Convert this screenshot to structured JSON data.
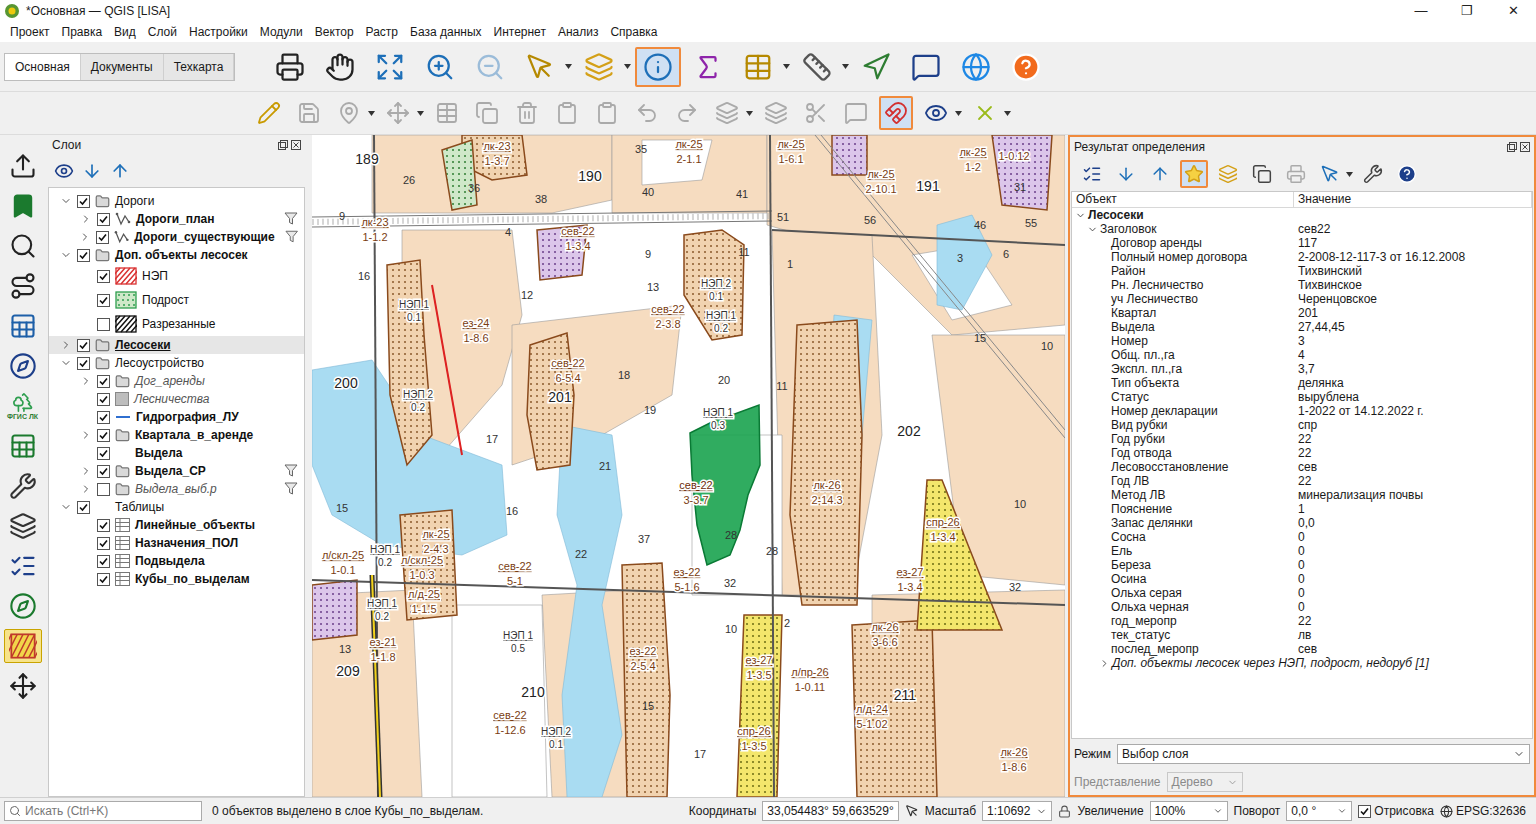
{
  "window": {
    "title": "*Основная — QGIS [LISA]",
    "controls": [
      "—",
      "❐",
      "✕"
    ]
  },
  "menu": [
    "Проект",
    "Правка",
    "Вид",
    "Слой",
    "Настройки",
    "Модули",
    "Вектор",
    "Растр",
    "База данных",
    "Интернет",
    "Анализ",
    "Справка"
  ],
  "ribbon_tabs": [
    {
      "label": "Основная",
      "selected": true
    },
    {
      "label": "Документы",
      "selected": false
    },
    {
      "label": "Техкарта",
      "selected": false
    }
  ],
  "toolbar_main": [
    {
      "pressed": false,
      "disabled": false,
      "dropdown": false
    },
    {
      "pressed": false,
      "disabled": false,
      "dropdown": false
    },
    {
      "pressed": false,
      "disabled": false,
      "dropdown": false
    },
    {
      "pressed": false,
      "disabled": false,
      "dropdown": false
    },
    {
      "pressed": false,
      "disabled": true,
      "dropdown": false
    },
    {
      "pressed": false,
      "disabled": false,
      "dropdown": true
    },
    {
      "pressed": false,
      "disabled": false,
      "dropdown": true
    },
    {
      "pressed": true,
      "disabled": false,
      "dropdown": false
    },
    {
      "pressed": false,
      "disabled": false,
      "dropdown": false
    },
    {
      "pressed": false,
      "disabled": false,
      "dropdown": true
    },
    {
      "pressed": false,
      "disabled": false,
      "dropdown": true
    },
    {
      "pressed": false,
      "disabled": false,
      "dropdown": false
    },
    {
      "pressed": false,
      "disabled": false,
      "dropdown": false
    },
    {
      "pressed": false,
      "disabled": false,
      "dropdown": false
    },
    {
      "pressed": false,
      "disabled": false,
      "dropdown": false
    }
  ],
  "toolbar_edit": [
    {
      "pressed": false,
      "disabled": false,
      "dropdown": false
    },
    {
      "pressed": false,
      "disabled": true,
      "dropdown": false
    },
    {
      "pressed": false,
      "disabled": true,
      "dropdown": true
    },
    {
      "pressed": false,
      "disabled": true,
      "dropdown": true
    },
    {
      "pressed": false,
      "disabled": true,
      "dropdown": false
    },
    {
      "pressed": false,
      "disabled": true,
      "dropdown": false
    },
    {
      "pressed": false,
      "disabled": true,
      "dropdown": false
    },
    {
      "pressed": false,
      "disabled": true,
      "dropdown": false
    },
    {
      "pressed": false,
      "disabled": true,
      "dropdown": false
    },
    {
      "pressed": false,
      "disabled": true,
      "dropdown": false
    },
    {
      "pressed": false,
      "disabled": true,
      "dropdown": false
    },
    {
      "pressed": false,
      "disabled": true,
      "dropdown": true
    },
    {
      "pressed": false,
      "disabled": true,
      "dropdown": false
    },
    {
      "pressed": false,
      "disabled": true,
      "dropdown": false
    },
    {
      "pressed": false,
      "disabled": true,
      "dropdown": false
    },
    {
      "pressed": true,
      "disabled": false,
      "dropdown": false
    },
    {
      "pressed": false,
      "disabled": false,
      "dropdown": true
    },
    {
      "pressed": false,
      "disabled": false,
      "dropdown": true
    }
  ],
  "left_tools": [
    {
      "label": "",
      "pressed": false
    },
    {
      "label": "",
      "pressed": false
    },
    {
      "label": "",
      "pressed": false
    },
    {
      "label": "",
      "pressed": false
    },
    {
      "label": "",
      "pressed": false
    },
    {
      "label": "",
      "pressed": false
    },
    {
      "label": "ФГИС ЛК",
      "pressed": false
    },
    {
      "label": "",
      "pressed": false
    },
    {
      "label": "",
      "pressed": false
    },
    {
      "label": "",
      "pressed": false
    },
    {
      "label": "",
      "pressed": false
    },
    {
      "label": "",
      "pressed": false
    },
    {
      "label": "",
      "pressed": true
    },
    {
      "label": "",
      "pressed": false
    }
  ],
  "layers_panel": {
    "title": "Слои",
    "items": [
      {
        "label": "Дороги",
        "level": 0,
        "kind": "group",
        "expandable": true,
        "expanded": true,
        "checked": true,
        "bold": false,
        "italic": false,
        "selected": false,
        "filter": false
      },
      {
        "label": "Дороги_план",
        "level": 1,
        "kind": "line-layer",
        "expandable": true,
        "expanded": false,
        "checked": true,
        "bold": true,
        "italic": false,
        "selected": false,
        "filter": true
      },
      {
        "label": "Дороги_существующие",
        "level": 1,
        "kind": "line-layer",
        "expandable": true,
        "expanded": false,
        "checked": true,
        "bold": true,
        "italic": false,
        "selected": false,
        "filter": true
      },
      {
        "label": "Доп. объекты лесосек",
        "level": 0,
        "kind": "group",
        "expandable": true,
        "expanded": true,
        "checked": true,
        "bold": true,
        "italic": false,
        "selected": false,
        "filter": false
      },
      {
        "label": "НЭП",
        "level": 1,
        "kind": "legend",
        "pattern": "hatch",
        "color": "#d93030",
        "expandable": false,
        "expanded": false,
        "checked": true,
        "bold": false,
        "italic": false,
        "selected": false,
        "filter": false
      },
      {
        "label": "Подрост",
        "level": 1,
        "kind": "legend",
        "pattern": "dots",
        "color": "#2e9e4f",
        "expandable": false,
        "expanded": false,
        "checked": true,
        "bold": false,
        "italic": false,
        "selected": false,
        "filter": false
      },
      {
        "label": "Разрезанные",
        "level": 1,
        "kind": "legend",
        "pattern": "hatch",
        "color": "#111111",
        "expandable": false,
        "expanded": false,
        "checked": false,
        "bold": false,
        "italic": false,
        "selected": false,
        "filter": false
      },
      {
        "label": "Лесосеки",
        "level": 0,
        "kind": "group",
        "expandable": true,
        "expanded": false,
        "checked": true,
        "bold": true,
        "italic": false,
        "selected": true,
        "filter": false
      },
      {
        "label": "Лесоустройство",
        "level": 0,
        "kind": "group",
        "expandable": true,
        "expanded": true,
        "checked": true,
        "bold": false,
        "italic": false,
        "selected": false,
        "filter": false
      },
      {
        "label": "Дог_аренды",
        "level": 1,
        "kind": "group",
        "expandable": true,
        "expanded": false,
        "checked": true,
        "bold": false,
        "italic": true,
        "selected": false,
        "filter": false
      },
      {
        "label": "Лесничества",
        "level": 1,
        "kind": "fill",
        "expandable": false,
        "expanded": false,
        "checked": true,
        "bold": false,
        "italic": true,
        "selected": false,
        "filter": false
      },
      {
        "label": "Гидрография_ЛУ",
        "level": 1,
        "kind": "line",
        "expandable": false,
        "expanded": false,
        "checked": true,
        "bold": true,
        "italic": false,
        "selected": false,
        "filter": false
      },
      {
        "label": "Квартала_в_аренде",
        "level": 1,
        "kind": "group",
        "expandable": true,
        "expanded": false,
        "checked": true,
        "bold": true,
        "italic": false,
        "selected": false,
        "filter": false
      },
      {
        "label": "Выдела",
        "level": 1,
        "kind": "none",
        "expandable": false,
        "expanded": false,
        "checked": true,
        "bold": true,
        "italic": false,
        "selected": false,
        "filter": false
      },
      {
        "label": "Выдела_СР",
        "level": 1,
        "kind": "group",
        "expandable": true,
        "expanded": false,
        "checked": true,
        "bold": true,
        "italic": false,
        "selected": false,
        "filter": true
      },
      {
        "label": "Выдела_выб.р",
        "level": 1,
        "kind": "group",
        "expandable": true,
        "expanded": false,
        "checked": false,
        "bold": false,
        "italic": true,
        "selected": false,
        "filter": true
      },
      {
        "label": "Таблицы",
        "level": 0,
        "kind": "none",
        "expandable": true,
        "expanded": true,
        "checked": true,
        "bold": false,
        "italic": false,
        "selected": false,
        "filter": false
      },
      {
        "label": "Линейные_объекты",
        "level": 1,
        "kind": "table",
        "expandable": false,
        "expanded": false,
        "checked": true,
        "bold": true,
        "italic": false,
        "selected": false,
        "filter": false
      },
      {
        "label": "Назначения_ПОЛ",
        "level": 1,
        "kind": "table",
        "expandable": false,
        "expanded": false,
        "checked": true,
        "bold": true,
        "italic": false,
        "selected": false,
        "filter": false
      },
      {
        "label": "Подвыдела",
        "level": 1,
        "kind": "table",
        "expandable": false,
        "expanded": false,
        "checked": true,
        "bold": true,
        "italic": false,
        "selected": false,
        "filter": false
      },
      {
        "label": "Кубы_по_выделам",
        "level": 1,
        "kind": "table",
        "expandable": false,
        "expanded": false,
        "checked": true,
        "bold": true,
        "italic": false,
        "selected": false,
        "filter": false
      }
    ]
  },
  "map": {
    "quarters": [
      "189",
      "190",
      "191",
      "200",
      "201",
      "202",
      "209",
      "210",
      "211"
    ],
    "parcels": [
      "26",
      "36",
      "35",
      "38",
      "40",
      "41",
      "31",
      "51",
      "56",
      "46",
      "55",
      "9",
      "4",
      "9",
      "11",
      "1",
      "3",
      "6",
      "16",
      "13",
      "12",
      "15",
      "10",
      "18",
      "20",
      "11",
      "19",
      "17",
      "21",
      "15",
      "16",
      "28",
      "10",
      "37",
      "22",
      "28",
      "32",
      "32",
      "2",
      "10",
      "13",
      "15",
      "17"
    ],
    "cuttings": [
      {
        "name": "лк-23",
        "area": "1-3.7",
        "selected": false
      },
      {
        "name": "лк-25",
        "area": "2-1.1",
        "selected": false
      },
      {
        "name": "лк-25",
        "area": "1-6.1",
        "selected": false
      },
      {
        "name": "лк-25",
        "area": "1-2",
        "selected": false
      },
      {
        "name": "лк-25",
        "area": "2-10.1",
        "selected": false
      },
      {
        "name": "лк-23",
        "area": "1-1.2",
        "selected": false
      },
      {
        "name": "сев-22",
        "area": "1-3.4",
        "selected": false
      },
      {
        "name": "ез-24",
        "area": "1-8.6",
        "selected": false
      },
      {
        "name": "сев-22",
        "area": "2-3.8",
        "selected": false
      },
      {
        "name": "сев-22",
        "area": "6-5.4",
        "selected": false
      },
      {
        "name": "лк-26",
        "area": "2-14.3",
        "selected": false
      },
      {
        "name": "сев-22",
        "area": "3-3.7",
        "selected": true
      },
      {
        "name": "спр-26",
        "area": "1-3.4",
        "selected": false
      },
      {
        "name": "лк-25",
        "area": "2-4.3",
        "selected": false
      },
      {
        "name": "л/скл-25",
        "area": "1-0.1",
        "selected": false
      },
      {
        "name": "л/скл-25",
        "area": "1-0.3",
        "selected": false
      },
      {
        "name": "сев-22",
        "area": "5-1",
        "selected": false
      },
      {
        "name": "ез-22",
        "area": "5-1.6",
        "selected": false
      },
      {
        "name": "ез-27",
        "area": "1-3.4",
        "selected": false
      },
      {
        "name": "л/д-25",
        "area": "1-1.5",
        "selected": false
      },
      {
        "name": "ез-22",
        "area": "2-5.4",
        "selected": false
      },
      {
        "name": "лк-26",
        "area": "3-6.6",
        "selected": false
      },
      {
        "name": "ез-21",
        "area": "1-1.8",
        "selected": false
      },
      {
        "name": "ез-27",
        "area": "1-3.5",
        "selected": false
      },
      {
        "name": "л/пр-26",
        "area": "1-0.11",
        "selected": false
      },
      {
        "name": "л/д-24",
        "area": "5-1.02",
        "selected": false
      },
      {
        "name": "сев-22",
        "area": "1-12.6",
        "selected": false
      },
      {
        "name": "спр-26",
        "area": "1-3.5",
        "selected": false
      },
      {
        "name": "лк-26",
        "area": "1-8.6",
        "selected": false
      }
    ],
    "nep": [
      {
        "name": "НЭП 1",
        "value": "0.1"
      },
      {
        "name": "НЭП 2",
        "value": "0.1"
      },
      {
        "name": "НЭП 1",
        "value": "0.2"
      },
      {
        "name": "НЭП 2",
        "value": "0.2"
      },
      {
        "name": "НЭП 1",
        "value": "0.3"
      },
      {
        "name": "НЭП 1",
        "value": "0.2"
      },
      {
        "name": "НЭП 1",
        "value": "0.2"
      },
      {
        "name": "НЭП 1",
        "value": "0.5"
      },
      {
        "name": "НЭП 2",
        "value": "0.1"
      }
    ],
    "codes": [
      "1-0.12"
    ]
  },
  "identify": {
    "title": "Результат определения",
    "toolbar": [
      {
        "pressed": false,
        "disabled": false,
        "dropdown": false
      },
      {
        "pressed": false,
        "disabled": false,
        "dropdown": false
      },
      {
        "pressed": false,
        "disabled": false,
        "dropdown": false
      },
      {
        "pressed": true,
        "disabled": false,
        "dropdown": false
      },
      {
        "pressed": false,
        "disabled": false,
        "dropdown": false
      },
      {
        "pressed": false,
        "disabled": false,
        "dropdown": false
      },
      {
        "pressed": false,
        "disabled": true,
        "dropdown": false
      },
      {
        "pressed": false,
        "disabled": false,
        "dropdown": true
      },
      {
        "pressed": false,
        "disabled": false,
        "dropdown": false
      },
      {
        "pressed": false,
        "disabled": false,
        "dropdown": false
      }
    ],
    "columns": [
      "Объект",
      "Значение"
    ],
    "layer": {
      "label": "Лесосеки",
      "expanded": true
    },
    "header": {
      "label": "Заголовок",
      "value": "сев22",
      "expanded": true
    },
    "attributes": [
      {
        "field": "Договор аренды",
        "value": "117"
      },
      {
        "field": "Полный номер договора",
        "value": "2-2008-12-117-3 от 16.12.2008"
      },
      {
        "field": "Район",
        "value": "Тихвинский"
      },
      {
        "field": "Рн. Лесничество",
        "value": "Тихвинское"
      },
      {
        "field": "уч Лесничество",
        "value": "Черенцовское"
      },
      {
        "field": "Квартал",
        "value": "201"
      },
      {
        "field": "Выдела",
        "value": "27,44,45"
      },
      {
        "field": "Номер",
        "value": "3"
      },
      {
        "field": "Общ. пл.,га",
        "value": "4"
      },
      {
        "field": "Экспл. пл.,га",
        "value": "3,7"
      },
      {
        "field": "Тип объекта",
        "value": "делянка"
      },
      {
        "field": "Статус",
        "value": "вырублена"
      },
      {
        "field": "Номер декларации",
        "value": "1-2022 от 14.12.2022 г."
      },
      {
        "field": "Вид рубки",
        "value": "спр"
      },
      {
        "field": "Год рубки",
        "value": "22"
      },
      {
        "field": "Год отвода",
        "value": "22"
      },
      {
        "field": "Лесовосстановление",
        "value": "сев"
      },
      {
        "field": "Год ЛВ",
        "value": "22"
      },
      {
        "field": "Метод ЛВ",
        "value": "минерализация почвы"
      },
      {
        "field": "Пояснение",
        "value": "1"
      },
      {
        "field": "Запас делянки",
        "value": "0,0"
      },
      {
        "field": "Сосна",
        "value": "0"
      },
      {
        "field": "Ель",
        "value": "0"
      },
      {
        "field": "Береза",
        "value": "0"
      },
      {
        "field": "Осина",
        "value": "0"
      },
      {
        "field": "Ольха серая",
        "value": "0"
      },
      {
        "field": "Ольха черная",
        "value": "0"
      },
      {
        "field": "год_меропр",
        "value": "22"
      },
      {
        "field": "тек_статус",
        "value": "лв"
      },
      {
        "field": "послед_меропр",
        "value": "сев"
      }
    ],
    "related": {
      "label": "Доп. объекты лесосек через НЭП, подрост, недоруб [1]",
      "expanded": false
    },
    "mode": {
      "label": "Режим",
      "value": "Выбор слоя"
    },
    "view": {
      "label": "Представление",
      "value": "Дерево",
      "disabled": true
    }
  },
  "status_bar": {
    "search_placeholder": "Искать (Ctrl+K)",
    "message": "0 объектов выделено в слое Кубы_по_выделам.",
    "coords_label": "Координаты",
    "coords": "33,054483° 59,663529°",
    "scale_label": "Масштаб",
    "scale": "1:10692",
    "magnifier_label": "Увеличение",
    "magnifier": "100%",
    "rotation_label": "Поворот",
    "rotation": "0,0 °",
    "render_label": "Отрисовка",
    "render_checked": true,
    "crs": "EPSG:32636"
  }
}
